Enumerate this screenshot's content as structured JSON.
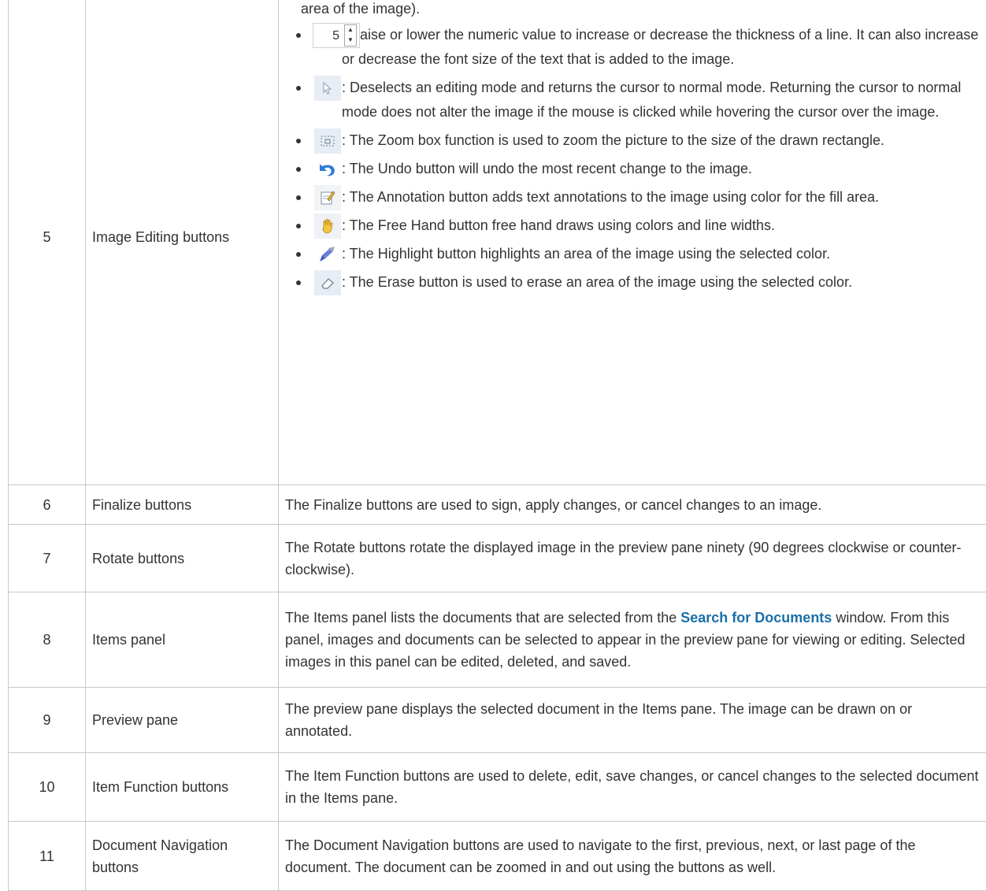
{
  "rows": [
    {
      "num": "5",
      "name": "Image Editing buttons",
      "intro": "area of the image).",
      "items": [
        {
          "icon": "numeric-spinner-icon",
          "spin_value": "5",
          "text": ":  Raise or lower the numeric value to increase or decrease the thickness of a line.  It can also increase or decrease the font size of the text that is added to the image."
        },
        {
          "icon": "cursor-arrow-icon",
          "text": ": Deselects an editing mode and returns the cursor to normal mode. Returning the cursor to normal mode does not alter the image if the mouse is clicked while hovering the cursor over the image."
        },
        {
          "icon": "zoom-box-icon",
          "text": ": The Zoom box function is used to zoom the picture to the size of the drawn rectangle."
        },
        {
          "icon": "undo-icon",
          "text": ":  The Undo button will undo the most recent change to the image."
        },
        {
          "icon": "annotation-icon",
          "text": ": The Annotation button adds text annotations to the image using color for the fill area."
        },
        {
          "icon": "free-hand-icon",
          "text": ": The Free Hand button free hand draws using colors and line widths."
        },
        {
          "icon": "highlight-icon",
          "text": ": The Highlight button highlights an area of the image using the selected color."
        },
        {
          "icon": "eraser-icon",
          "text": ": The Erase button is used to erase an area of the image using the selected color."
        }
      ]
    },
    {
      "num": "6",
      "name": "Finalize buttons",
      "desc": "The Finalize buttons are used to sign, apply changes, or cancel changes to an image."
    },
    {
      "num": "7",
      "name": "Rotate buttons",
      "desc": "The Rotate buttons rotate the displayed image in the preview pane ninety (90 degrees clockwise or counter-clockwise)."
    },
    {
      "num": "8",
      "name": "Items panel",
      "desc_before": "The Items panel lists the documents that are selected from the ",
      "link": "Search for Documents",
      "desc_after": " window. From this panel, images and documents can be selected to appear in the preview pane for viewing or editing. Selected images in this panel can be edited, deleted, and saved."
    },
    {
      "num": "9",
      "name": "Preview pane",
      "desc": "The preview pane displays the selected document in the Items pane. The image can be drawn on or annotated."
    },
    {
      "num": "10",
      "name": "Item Function buttons",
      "desc": "The Item Function buttons are used to delete, edit, save changes, or cancel changes to the selected document in the Items pane."
    },
    {
      "num": "11",
      "name": "Document Navigation buttons",
      "desc": "The Document Navigation buttons are used to navigate to the first, previous, next, or last page of the document.  The document can be zoomed in and out using the buttons as well."
    }
  ],
  "colors": {
    "link": "#1a6fa8",
    "border": "#c8c8c8",
    "text": "#333333",
    "icon_bg": "#e7edf4"
  }
}
